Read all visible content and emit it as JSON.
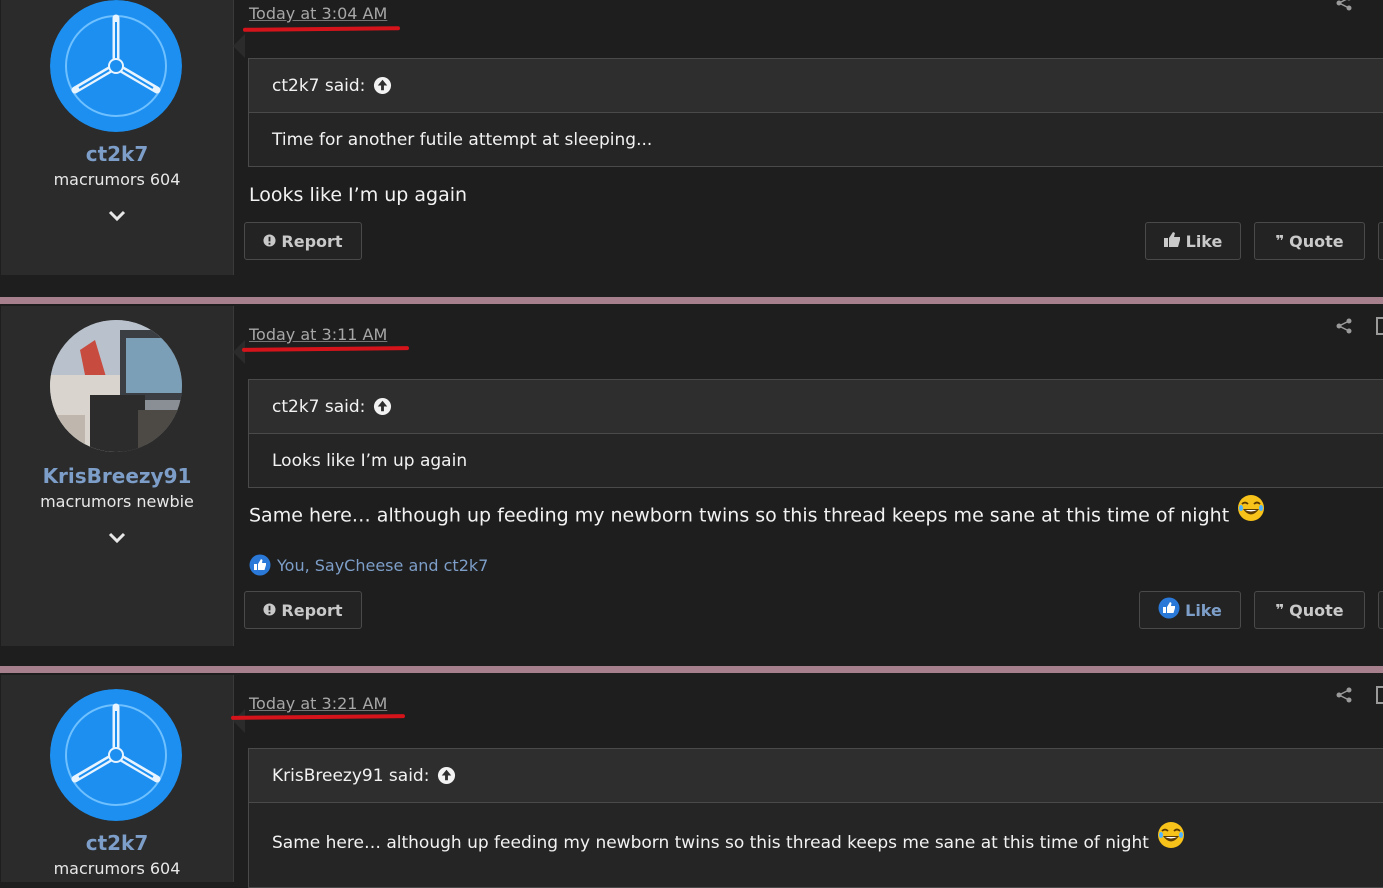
{
  "posts": [
    {
      "username": "ct2k7",
      "user_title": "macrumors 604",
      "timestamp": "Today at 3:04 AM",
      "quote_author": "ct2k7 said:",
      "quote_text": "Time for another futile attempt at sleeping...",
      "message": "Looks like I’m up again",
      "report_label": "Report",
      "like_label": "Like",
      "quote_label": "Quote"
    },
    {
      "username": "KrisBreezy91",
      "user_title": "macrumors newbie",
      "timestamp": "Today at 3:11 AM",
      "quote_author": "ct2k7 said:",
      "quote_text": "Looks like I’m up again",
      "message": "Same here… although up feeding my newborn twins so this thread keeps me sane at this time of night",
      "reactions": "You, SayCheese and ct2k7",
      "report_label": "Report",
      "like_label": "Like",
      "quote_label": "Quote"
    },
    {
      "username": "ct2k7",
      "user_title": "macrumors 604",
      "timestamp": "Today at 3:21 AM",
      "quote_author": "KrisBreezy91 said:",
      "quote_text": "Same here… although up feeding my newborn twins so this thread keeps me sane at this time of night"
    }
  ],
  "colors": {
    "separator": "#a6808d",
    "username": "#7d9ec8",
    "annotation_underline": "#d4141a",
    "avatar_blue": "#1c8ff0"
  },
  "icons": [
    "share-icon",
    "bookmark-icon",
    "chevron-down-icon",
    "arrow-up-circle-icon",
    "report-icon",
    "like-icon",
    "quote-icon",
    "laughing-emoji"
  ]
}
